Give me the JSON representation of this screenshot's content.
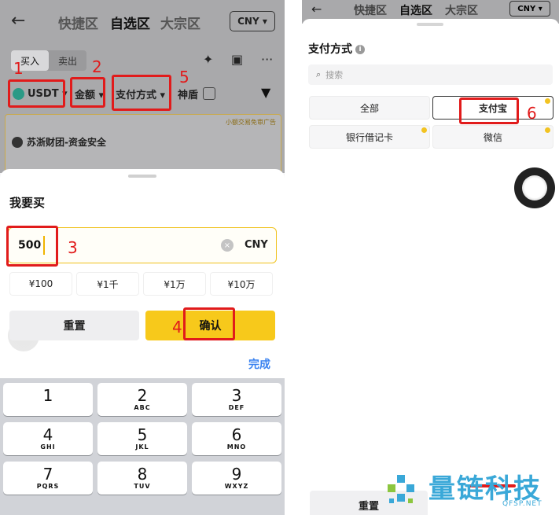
{
  "left": {
    "nav": {
      "back": "←",
      "tabs": [
        "快捷区",
        "自选区",
        "大宗区"
      ],
      "currency": "CNY ▾"
    },
    "trade": {
      "buy": "买入",
      "sell": "卖出"
    },
    "filters": {
      "coin": "USDT ▾",
      "amount": "金额 ▾",
      "payment": "支付方式 ▾",
      "shield": "神盾"
    },
    "card": {
      "tag": "小额交易免审广告",
      "title": "苏浙财团-资金安全"
    },
    "sheet": {
      "title": "我要买",
      "amount_value": "500",
      "amount_unit": "CNY",
      "clear": "×",
      "quick_amounts": [
        "¥100",
        "¥1千",
        "¥1万",
        "¥10万"
      ],
      "reset": "重置",
      "confirm": "确认",
      "done": "完成"
    },
    "keypad": [
      {
        "digit": "1",
        "letters": ""
      },
      {
        "digit": "2",
        "letters": "ABC"
      },
      {
        "digit": "3",
        "letters": "DEF"
      },
      {
        "digit": "4",
        "letters": "GHI"
      },
      {
        "digit": "5",
        "letters": "JKL"
      },
      {
        "digit": "6",
        "letters": "MNO"
      },
      {
        "digit": "7",
        "letters": "PQRS"
      },
      {
        "digit": "8",
        "letters": "TUV"
      },
      {
        "digit": "9",
        "letters": "WXYZ"
      }
    ],
    "annotations": [
      "1",
      "2",
      "3",
      "4",
      "5"
    ]
  },
  "right": {
    "nav": {
      "back": "←",
      "tabs": [
        "快捷区",
        "自选区",
        "大宗区"
      ],
      "currency": "CNY ▾"
    },
    "sheet": {
      "title": "支付方式",
      "search_placeholder": "搜索",
      "options": [
        "全部",
        "支付宝",
        "银行借记卡",
        "微信"
      ],
      "selected": "支付宝",
      "reset": "重置"
    },
    "annotations": [
      "6"
    ]
  },
  "watermark": {
    "brand": "量链科技",
    "domain": "QFSP.NET"
  },
  "colors": {
    "accent": "#f7c91b",
    "annotation": "#e11b1b",
    "link": "#3a82f0",
    "watermark": "#3aa8d8"
  }
}
